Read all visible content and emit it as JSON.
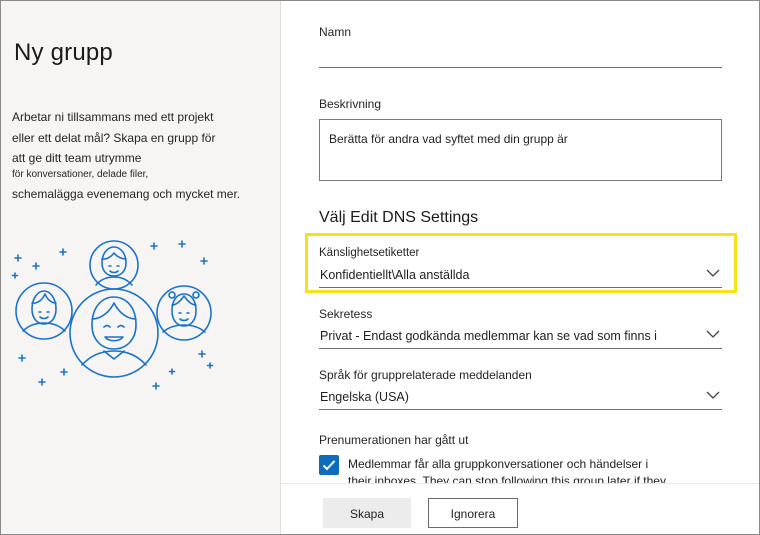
{
  "left_panel": {
    "title": "Ny grupp",
    "description_lines": [
      "Arbetar ni tillsammans med ett projekt",
      "eller ett delat mål? Skapa en grupp för",
      "att ge ditt team utrymme",
      "för konversationer, delade filer,",
      "schemalägga evenemang och mycket mer."
    ],
    "illustration": "people-group-illustration"
  },
  "form": {
    "name_label": "Namn",
    "name_value": "",
    "description_label": "Beskrivning",
    "description_value": "Berätta för andra vad syftet med din grupp är",
    "section_title": "Välj Edit DNS Settings",
    "sensitivity": {
      "label": "Känslighetsetiketter",
      "value": "Konfidentiellt\\Alla anställda"
    },
    "privacy": {
      "label": "Sekretess",
      "value": "Privat - Endast godkända medlemmar kan se vad som finns i"
    },
    "language": {
      "label": "Språk för grupprelaterade meddelanden",
      "value": "Engelska (USA)"
    },
    "subscription": {
      "label": "Prenumerationen har gått ut",
      "checked": true,
      "text_line1": "Medlemmar får alla gruppkonversationer och händelser i",
      "text_line2": "their inboxes. They can stop following this group later if they"
    }
  },
  "footer": {
    "create_label": "Skapa",
    "cancel_label": "Ignorera"
  },
  "colors": {
    "highlight": "#f2e31b",
    "accent": "#0f6cbd",
    "illustration": "#1a73c8"
  }
}
